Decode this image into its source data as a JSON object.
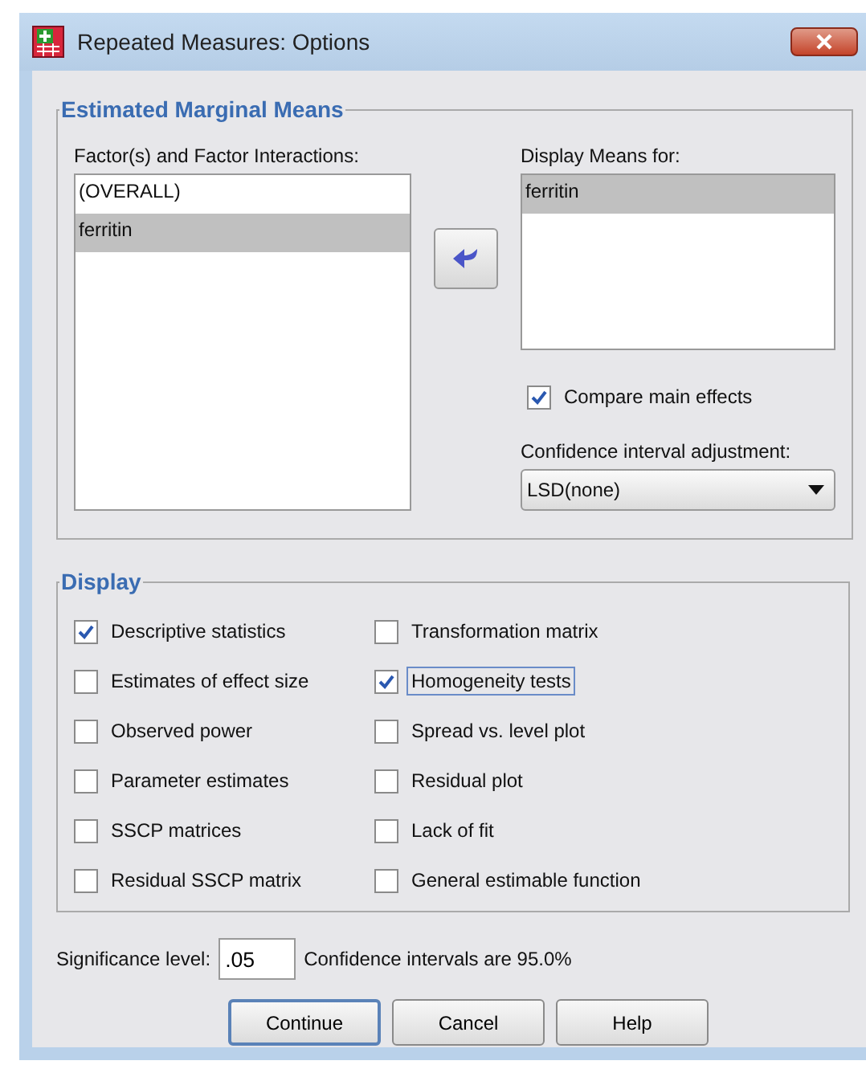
{
  "window": {
    "title": "Repeated Measures: Options"
  },
  "estimated_marginal_means": {
    "title": "Estimated Marginal Means",
    "factors_label": "Factor(s) and Factor Interactions:",
    "factors": [
      {
        "label": "(OVERALL)",
        "selected": false
      },
      {
        "label": "ferritin",
        "selected": true
      }
    ],
    "display_means_label": "Display Means for:",
    "display_means": [
      {
        "label": "ferritin",
        "selected": true
      }
    ],
    "compare_main_effects": {
      "label": "Compare main effects",
      "checked": true
    },
    "adjustment_label": "Confidence interval adjustment:",
    "adjustment": {
      "value": "LSD(none)"
    }
  },
  "display": {
    "title": "Display",
    "options": [
      {
        "label": "Descriptive statistics",
        "checked": true,
        "focused": false
      },
      {
        "label": "Transformation matrix",
        "checked": false,
        "focused": false
      },
      {
        "label": "Estimates of effect size",
        "checked": false,
        "focused": false
      },
      {
        "label": "Homogeneity tests",
        "checked": true,
        "focused": true
      },
      {
        "label": "Observed power",
        "checked": false,
        "focused": false
      },
      {
        "label": "Spread vs. level plot",
        "checked": false,
        "focused": false
      },
      {
        "label": "Parameter estimates",
        "checked": false,
        "focused": false
      },
      {
        "label": "Residual plot",
        "checked": false,
        "focused": false
      },
      {
        "label": "SSCP matrices",
        "checked": false,
        "focused": false
      },
      {
        "label": "Lack of fit",
        "checked": false,
        "focused": false
      },
      {
        "label": "Residual SSCP matrix",
        "checked": false,
        "focused": false
      },
      {
        "label": "General estimable function",
        "checked": false,
        "focused": false
      }
    ]
  },
  "significance": {
    "label": "Significance level:",
    "value": ".05",
    "note": "Confidence intervals are 95.0%"
  },
  "buttons": [
    {
      "label": "Continue",
      "default": true
    },
    {
      "label": "Cancel",
      "default": false
    },
    {
      "label": "Help",
      "default": false
    }
  ]
}
